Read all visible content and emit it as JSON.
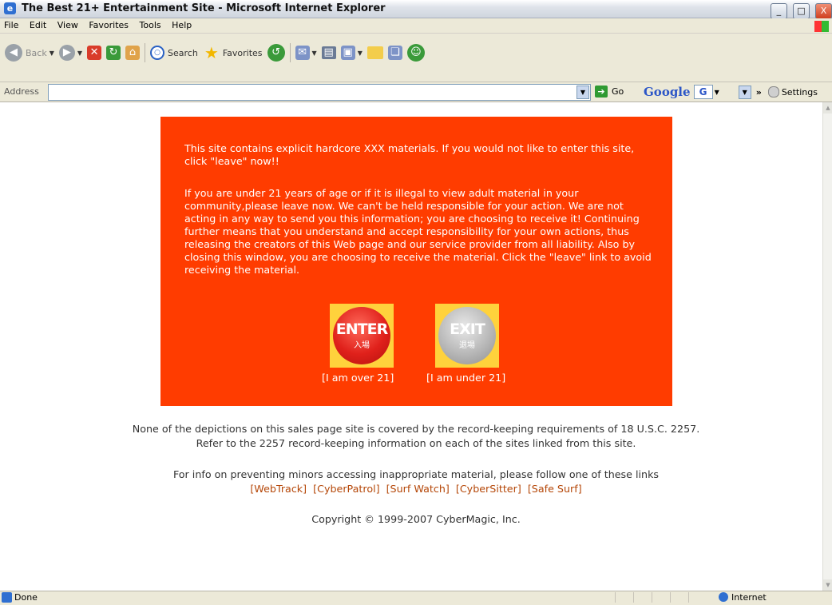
{
  "window": {
    "title": "The Best 21+ Entertainment Site - Microsoft Internet Explorer",
    "min_icon": "_",
    "max_icon": "□",
    "close_icon": "X"
  },
  "menu": [
    "File",
    "Edit",
    "View",
    "Favorites",
    "Tools",
    "Help"
  ],
  "toolbar": {
    "back_label": "Back",
    "search_label": "Search",
    "favorites_label": "Favorites"
  },
  "address": {
    "label": "Address",
    "value": "",
    "go_label": "Go"
  },
  "google": {
    "logo": "Google",
    "g_button": "G",
    "more": "»",
    "settings_label": "Settings"
  },
  "notice": {
    "para1": "This site contains explicit hardcore XXX materials. If you would not like to enter this site, click \"leave\" now!!",
    "para2": "If you are under 21 years of age or if it is illegal to view adult material in your community,please leave now. We can't be held responsible for your action. We are not acting in any way to send you this information; you are choosing to receive it! Continuing further means that you understand and accept responsibility for your own actions, thus releasing the creators of this Web page and our service provider from all liability. Also by closing this window, you are choosing to receive the material. Click the \"leave\" link to avoid receiving the material.",
    "enter_big": "ENTER",
    "enter_small": "入場",
    "enter_caption": "[I am over 21]",
    "exit_big": "EXIT",
    "exit_small": "退場",
    "exit_caption": "[I am under 21]"
  },
  "footer": {
    "line1": "None of the depictions on this sales page site is covered by the record-keeping requirements of 18 U.S.C. 2257.",
    "line2": "Refer to the 2257 record-keeping information on each of the sites linked from this site.",
    "line3": "For info on preventing minors accessing inappropriate material, please follow one of these links",
    "links": [
      "[WebTrack]",
      "[CyberPatrol]",
      "[Surf Watch]",
      "[CyberSitter]",
      "[Safe Surf]"
    ],
    "copyright": "Copyright © 1999-2007 CyberMagic, Inc."
  },
  "status": {
    "text": "Done",
    "zone": "Internet"
  },
  "colors": {
    "panel_bg": "#ff3c00",
    "button_frame": "#ffd23c",
    "link": "#b54708"
  },
  "icons": [
    "ie-icon",
    "back-icon",
    "forward-icon",
    "stop-icon",
    "refresh-icon",
    "home-icon",
    "search-icon",
    "favorites-icon",
    "history-icon",
    "mail-icon",
    "print-icon",
    "folder-icon",
    "research-icon",
    "messenger-icon",
    "go-arrow-icon",
    "globe-icon"
  ]
}
